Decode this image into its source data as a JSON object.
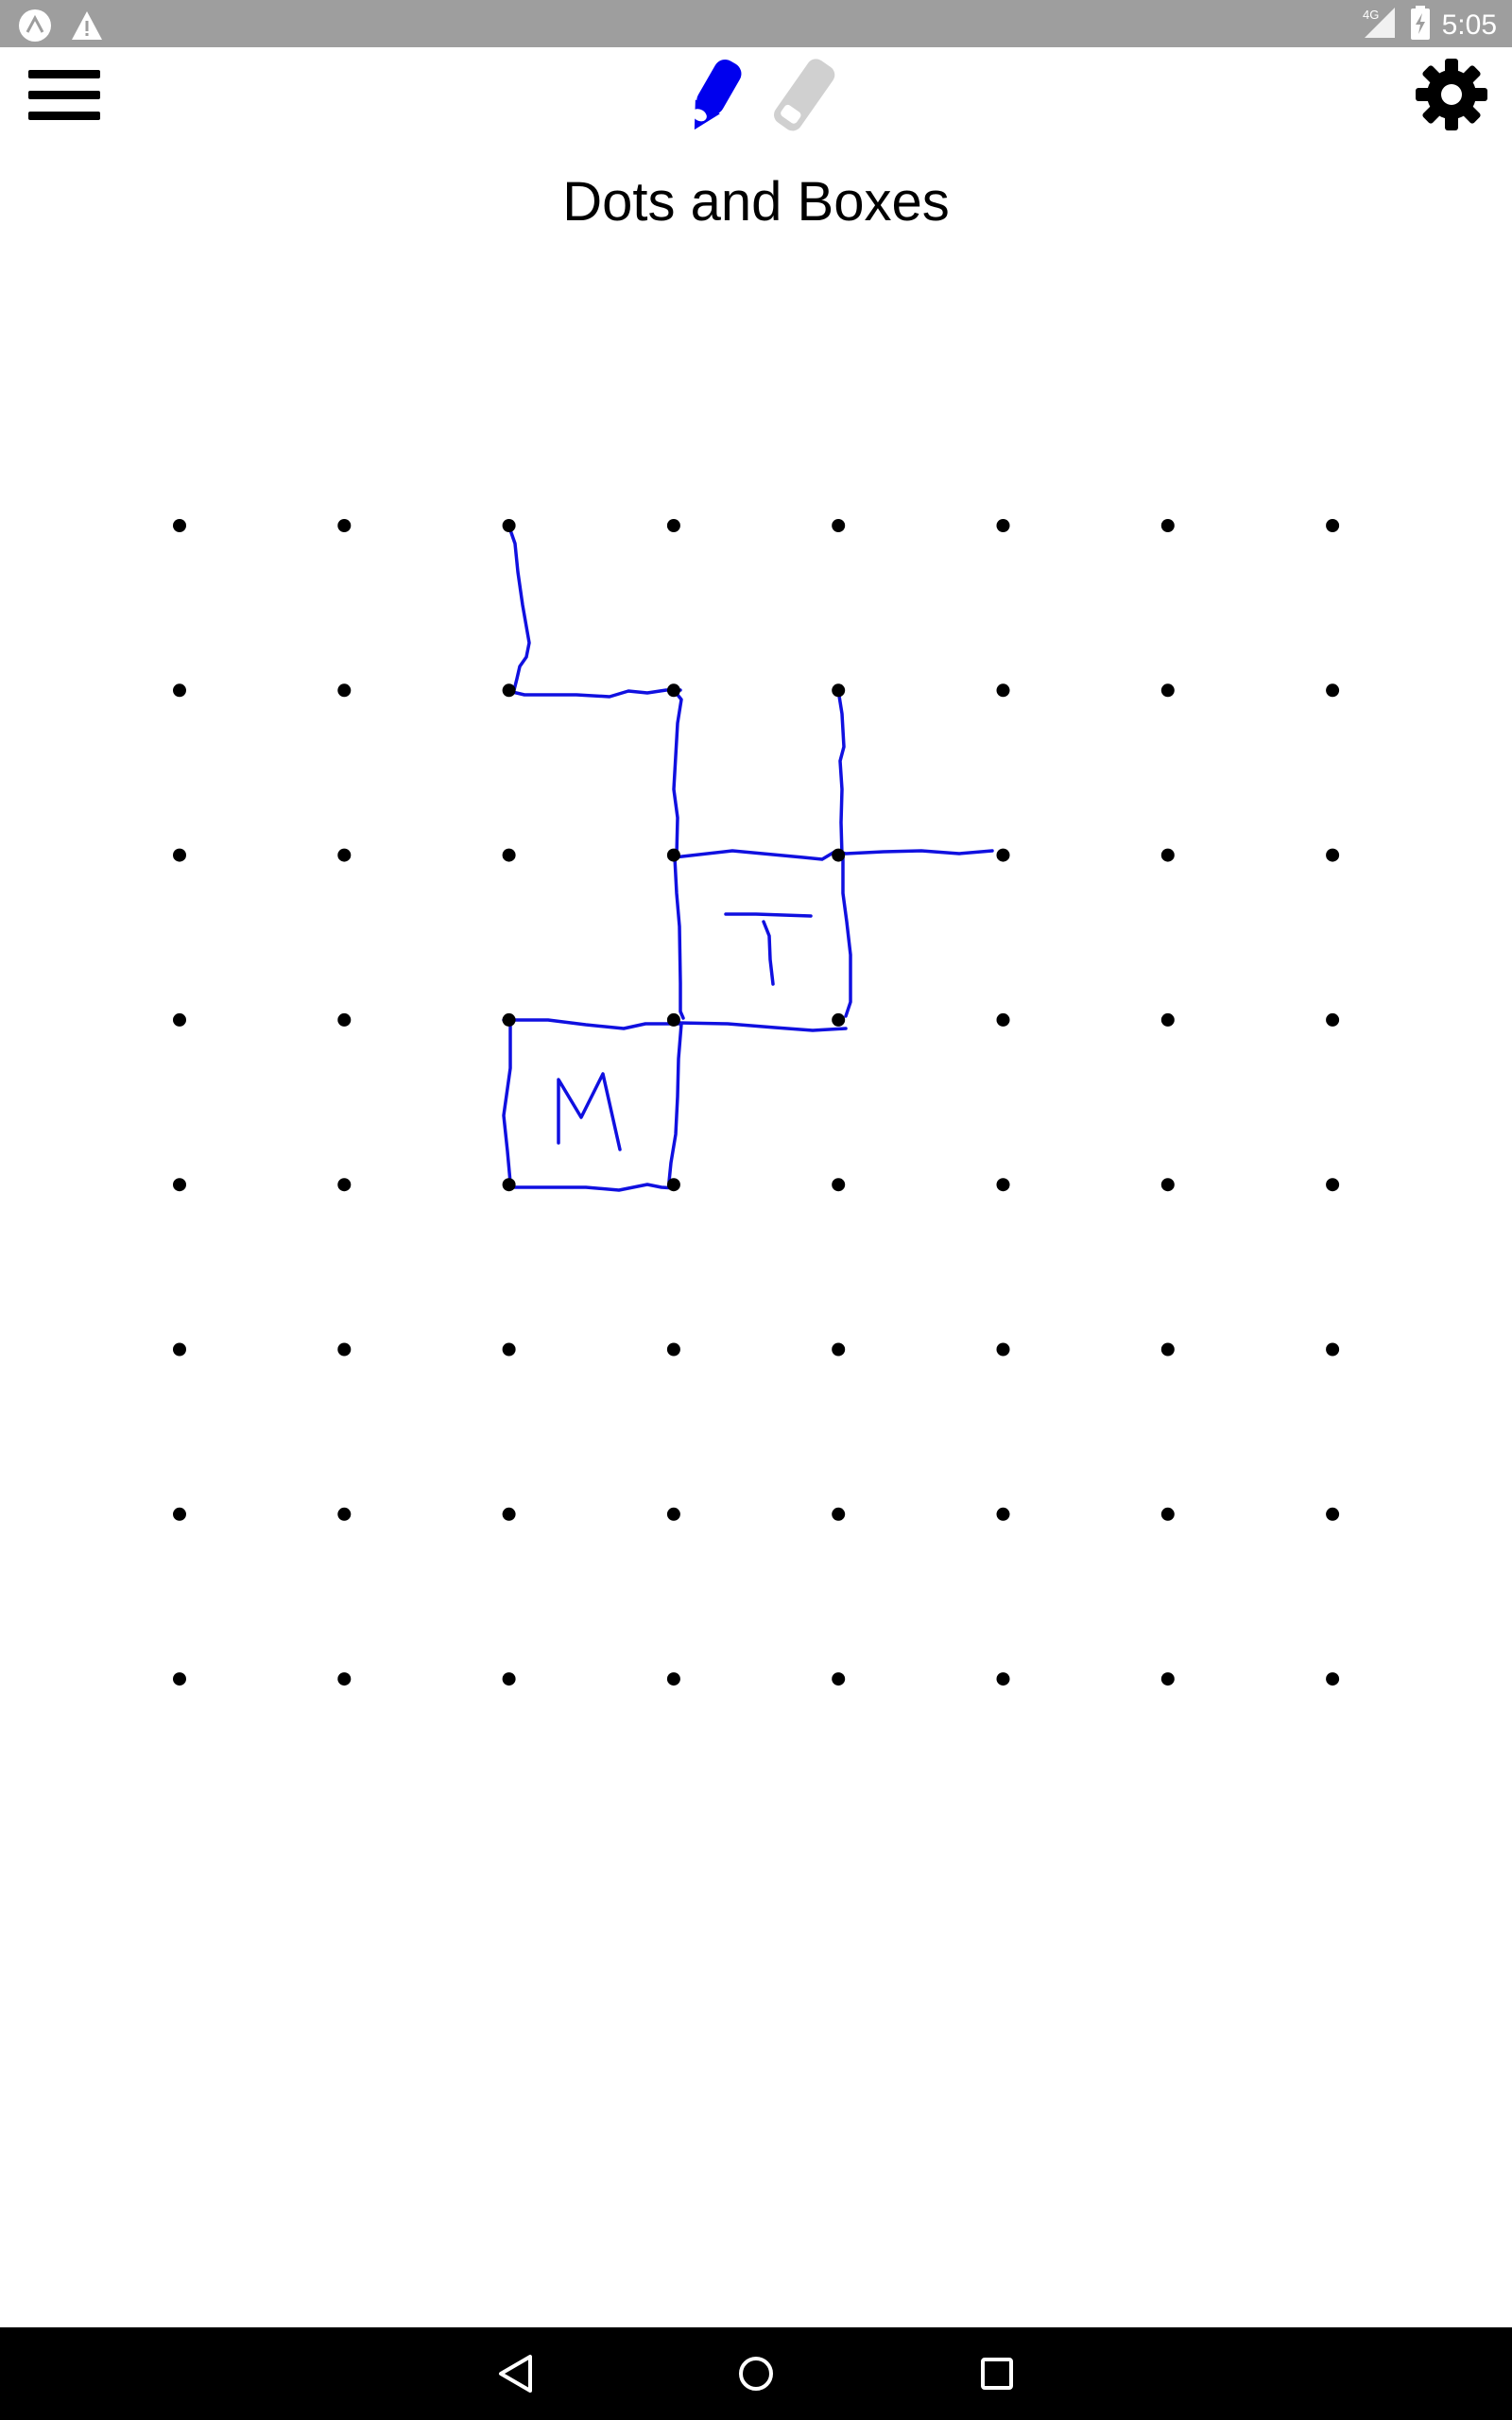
{
  "status_bar": {
    "time": "5:05",
    "network": "4G",
    "icons": [
      "app-notification-icon",
      "warning-icon",
      "signal-icon",
      "battery-charging-icon"
    ]
  },
  "toolbar": {
    "menu_icon": "hamburger-menu-icon",
    "pen_icon": "pen-icon",
    "eraser_icon": "eraser-icon",
    "settings_icon": "gear-icon",
    "active_tool": "pen"
  },
  "title": "Dots and Boxes",
  "board": {
    "rows": 8,
    "cols": 8,
    "ink_color": "#1010e0",
    "dot_color": "#000000",
    "boxes": [
      {
        "label": "T"
      },
      {
        "label": "M"
      }
    ]
  },
  "colors": {
    "status_bar": "#9e9e9e",
    "pen_active": "#0000ee",
    "eraser_inactive": "#d0d0d0",
    "nav_bar": "#000000"
  },
  "nav_bar": {
    "icons": [
      "back-icon",
      "home-icon",
      "recents-icon"
    ]
  }
}
